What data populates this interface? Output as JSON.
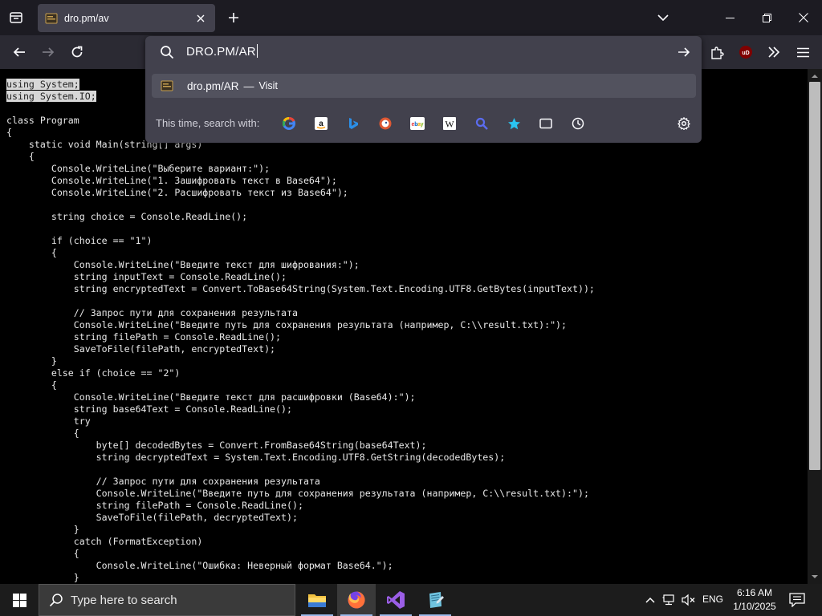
{
  "browser": {
    "tab": {
      "title": "dro.pm/av"
    },
    "urlbar": {
      "value": "DRO.PM/AR",
      "result": {
        "title": "dro.pm/AR",
        "separator": "—",
        "action": "Visit"
      },
      "search_with_label": "This time, search with:",
      "engines": [
        "google-icon",
        "amazon-icon",
        "bing-icon",
        "duckduckgo-icon",
        "ebay-icon",
        "wikipedia-icon",
        "search-icon",
        "bookmarks-star-icon",
        "tabs-icon",
        "history-icon"
      ],
      "extension_badge": "uD"
    },
    "colors": {
      "tabstrip_bg": "#1c1b22",
      "navbar_bg": "#2b2a33",
      "panel_bg": "#42414d",
      "selection": "#d7d7d7"
    }
  },
  "page": {
    "code_lines": [
      "using System;",
      "using System.IO;",
      "",
      "class Program",
      "{",
      "    static void Main(string[] args)",
      "    {",
      "        Console.WriteLine(\"Выберите вариант:\");",
      "        Console.WriteLine(\"1. Зашифровать текст в Base64\");",
      "        Console.WriteLine(\"2. Расшифровать текст из Base64\");",
      "",
      "        string choice = Console.ReadLine();",
      "",
      "        if (choice == \"1\")",
      "        {",
      "            Console.WriteLine(\"Введите текст для шифрования:\");",
      "            string inputText = Console.ReadLine();",
      "            string encryptedText = Convert.ToBase64String(System.Text.Encoding.UTF8.GetBytes(inputText));",
      "",
      "            // Запрос пути для сохранения результата",
      "            Console.WriteLine(\"Введите путь для сохранения результата (например, C:\\\\result.txt):\");",
      "            string filePath = Console.ReadLine();",
      "            SaveToFile(filePath, encryptedText);",
      "        }",
      "        else if (choice == \"2\")",
      "        {",
      "            Console.WriteLine(\"Введите текст для расшифровки (Base64):\");",
      "            string base64Text = Console.ReadLine();",
      "            try",
      "            {",
      "                byte[] decodedBytes = Convert.FromBase64String(base64Text);",
      "                string decryptedText = System.Text.Encoding.UTF8.GetString(decodedBytes);",
      "",
      "                // Запрос пути для сохранения результата",
      "                Console.WriteLine(\"Введите путь для сохранения результата (например, C:\\\\result.txt):\");",
      "                string filePath = Console.ReadLine();",
      "                SaveToFile(filePath, decryptedText);",
      "            }",
      "            catch (FormatException)",
      "            {",
      "                Console.WriteLine(\"Ошибка: Неверный формат Base64.\");",
      "            }"
    ],
    "selected_lines": [
      0,
      1
    ]
  },
  "taskbar": {
    "search_placeholder": "Type here to search",
    "apps": [
      "file-explorer-icon",
      "firefox-icon",
      "visual-studio-icon",
      "notepad-icon"
    ],
    "language": "ENG",
    "time": "6:16 AM",
    "date": "1/10/2025"
  }
}
